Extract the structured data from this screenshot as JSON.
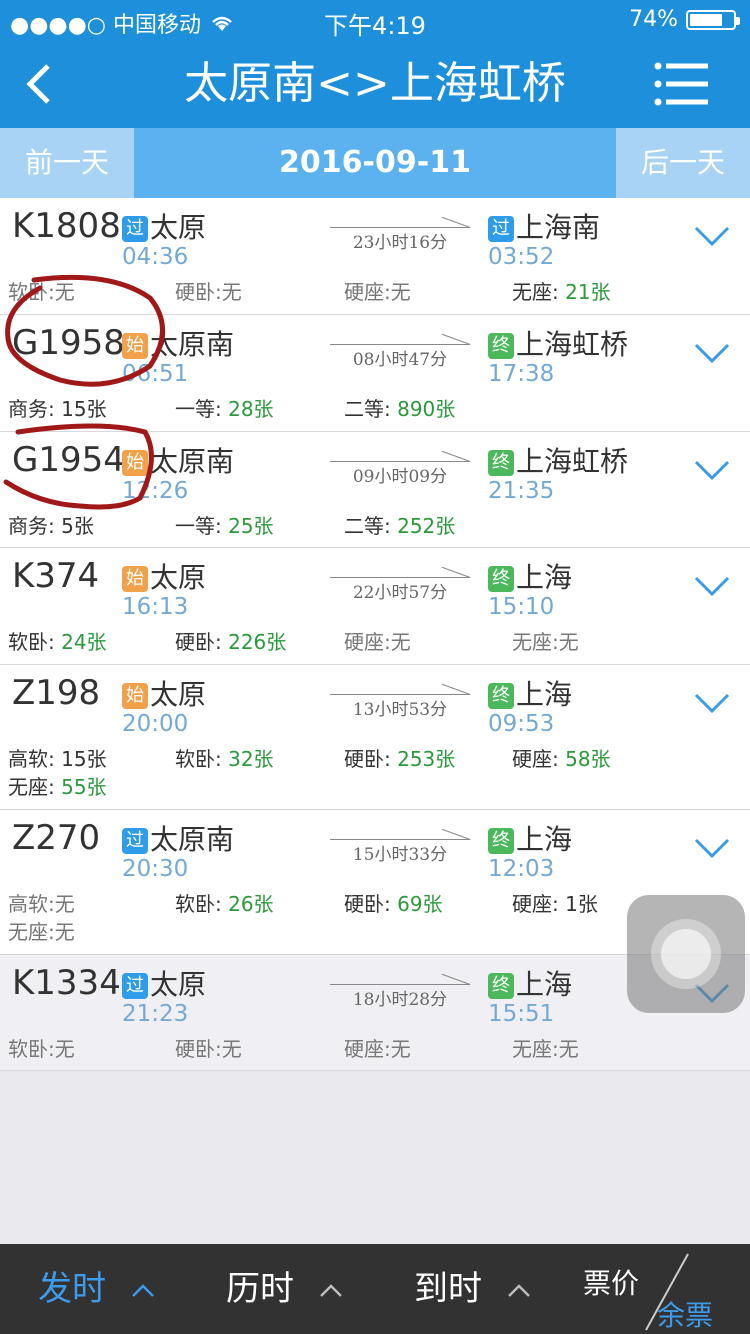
{
  "status": {
    "carrier": "●●●●○ 中国移动",
    "time": "下午4:19",
    "battery": "74%"
  },
  "nav": {
    "title": "太原南<>上海虹桥",
    "back_label": "<"
  },
  "datebar": {
    "prev": "前一天",
    "date": "2016-09-11",
    "next": "后一天"
  },
  "trains": [
    {
      "no": "K1808",
      "dep_badge": "过",
      "dep": "太原",
      "dep_time": "04:36",
      "dur": "23小时16分",
      "arr_badge": "过",
      "arr": "上海南",
      "arr_time": "03:52",
      "seats": [
        {
          "label": "软卧:无",
          "value": ""
        },
        {
          "label": "硬卧:无",
          "value": ""
        },
        {
          "label": "硬座:无",
          "value": ""
        },
        {
          "label": "无座: ",
          "value": "21张"
        }
      ]
    },
    {
      "no": "G1958",
      "dep_badge": "始",
      "dep": "太原南",
      "dep_time": "06:51",
      "dur": "08小时47分",
      "arr_badge": "终",
      "arr": "上海虹桥",
      "arr_time": "17:38",
      "seats": [
        {
          "label": "商务: 15张",
          "value": ""
        },
        {
          "label": "一等: ",
          "value": "28张"
        },
        {
          "label": "二等: ",
          "value": "890张"
        }
      ]
    },
    {
      "no": "G1954",
      "dep_badge": "始",
      "dep": "太原南",
      "dep_time": "12:26",
      "dur": "09小时09分",
      "arr_badge": "终",
      "arr": "上海虹桥",
      "arr_time": "21:35",
      "seats": [
        {
          "label": "商务: 5张",
          "value": ""
        },
        {
          "label": "一等: ",
          "value": "25张"
        },
        {
          "label": "二等: ",
          "value": "252张"
        }
      ]
    },
    {
      "no": "K374",
      "dep_badge": "始",
      "dep": "太原",
      "dep_time": "16:13",
      "dur": "22小时57分",
      "arr_badge": "终",
      "arr": "上海",
      "arr_time": "15:10",
      "seats": [
        {
          "label": "软卧: ",
          "value": "24张"
        },
        {
          "label": "硬卧: ",
          "value": "226张"
        },
        {
          "label": "硬座:无",
          "value": ""
        },
        {
          "label": "无座:无",
          "value": ""
        }
      ]
    },
    {
      "no": "Z198",
      "dep_badge": "始",
      "dep": "太原",
      "dep_time": "20:00",
      "dur": "13小时53分",
      "arr_badge": "终",
      "arr": "上海",
      "arr_time": "09:53",
      "seats": [
        {
          "label": "高软: 15张",
          "value": ""
        },
        {
          "label": "软卧: ",
          "value": "32张"
        },
        {
          "label": "硬卧: ",
          "value": "253张"
        },
        {
          "label": "硬座: ",
          "value": "58张"
        },
        {
          "label": "无座: ",
          "value": "55张"
        }
      ]
    },
    {
      "no": "Z270",
      "dep_badge": "过",
      "dep": "太原南",
      "dep_time": "20:30",
      "dur": "15小时33分",
      "arr_badge": "终",
      "arr": "上海",
      "arr_time": "12:03",
      "seats": [
        {
          "label": "高软:无",
          "value": ""
        },
        {
          "label": "软卧: ",
          "value": "26张"
        },
        {
          "label": "硬卧: ",
          "value": "69张"
        },
        {
          "label": "硬座: 1张",
          "value": ""
        },
        {
          "label": "无座:无",
          "value": ""
        }
      ]
    },
    {
      "no": "K1334",
      "dep_badge": "过",
      "dep": "太原",
      "dep_time": "21:23",
      "dur": "18小时28分",
      "arr_badge": "终",
      "arr": "上海",
      "arr_time": "15:51",
      "seats": [
        {
          "label": "软卧:无",
          "value": ""
        },
        {
          "label": "硬卧:无",
          "value": ""
        },
        {
          "label": "硬座:无",
          "value": ""
        },
        {
          "label": "无座:无",
          "value": ""
        }
      ]
    }
  ],
  "bottom": {
    "sort_dep": "发时",
    "sort_dur": "历时",
    "sort_arr": "到时",
    "fee": "票价",
    "remain": "余票"
  },
  "colors": {
    "bar": "#1e8fdb",
    "green": "#2a9a3a",
    "time_blue": "#74a9d6",
    "annotation": "#a01818"
  }
}
